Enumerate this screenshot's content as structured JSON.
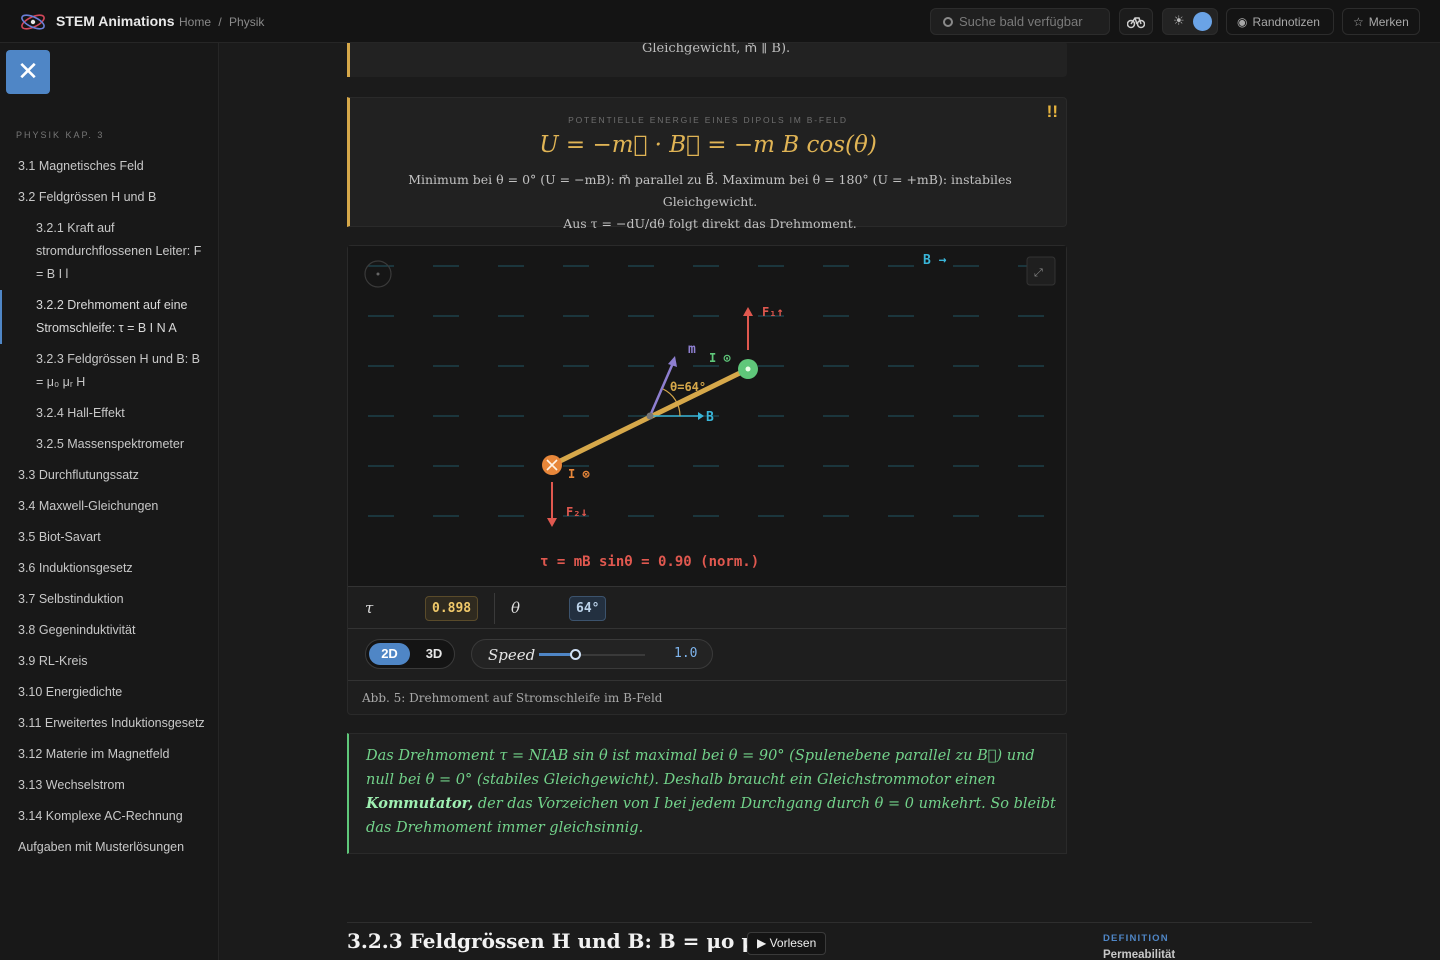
{
  "header": {
    "brand": "STEM Animations",
    "breadcrumbs": [
      "Home",
      "/",
      "Physik"
    ],
    "search_placeholder": "Suche bald verfügbar",
    "rand_label": "Randnotizen",
    "merken_label": "Merken"
  },
  "sidebar": {
    "heading": "PHYSIK KAP. 3",
    "items": [
      {
        "label": "3.1 Magnetisches Feld",
        "level": 1
      },
      {
        "label": "3.2 Feldgrössen H und B",
        "level": 1
      },
      {
        "label": "3.2.1 Kraft auf stromdurchflossenen Leiter: F = B I l",
        "level": 2
      },
      {
        "label": "3.2.2 Drehmoment auf eine Stromschleife: τ = B I N A",
        "level": 2,
        "active": true
      },
      {
        "label": "3.2.3 Feldgrössen H und B: B = μ₀ μᵣ H",
        "level": 2
      },
      {
        "label": "3.2.4 Hall-Effekt",
        "level": 2
      },
      {
        "label": "3.2.5 Massenspektrometer",
        "level": 2
      },
      {
        "label": "3.3 Durchflutungssatz",
        "level": 1
      },
      {
        "label": "3.4 Maxwell-Gleichungen",
        "level": 1
      },
      {
        "label": "3.5 Biot-Savart",
        "level": 1
      },
      {
        "label": "3.6 Induktionsgesetz",
        "level": 1
      },
      {
        "label": "3.7 Selbstinduktion",
        "level": 1
      },
      {
        "label": "3.8 Gegeninduktivität",
        "level": 1
      },
      {
        "label": "3.9 RL-Kreis",
        "level": 1
      },
      {
        "label": "3.10 Energiedichte",
        "level": 1
      },
      {
        "label": "3.11 Erweitertes Induktionsgesetz",
        "level": 1
      },
      {
        "label": "3.12 Materie im Magnetfeld",
        "level": 1
      },
      {
        "label": "3.13 Wechselstrom",
        "level": 1
      },
      {
        "label": "3.14 Komplexe AC-Rechnung",
        "level": 1
      },
      {
        "label": "Aufgaben mit Musterlösungen",
        "level": 1
      }
    ]
  },
  "prev_box": {
    "text": "Gleichgewicht, m⃗ ∥ B)."
  },
  "energy_box": {
    "label": "POTENTIELLE ENERGIE EINES DIPOLS IM B-FELD",
    "formula": "U = −m⃗ · B⃗ = −m B cos(θ)",
    "desc_line1": "Minimum bei θ = 0° (U = −mB): m⃗ parallel zu B⃗. Maximum bei θ = 180° (U = +mB): instabiles Gleichgewicht.",
    "desc_line2": "Aus τ = −dU/dθ folgt direkt das Drehmoment.",
    "badge": "!!"
  },
  "figure": {
    "labels": {
      "b_field": "B →",
      "f1": "F₁↑",
      "f2": "F₂↓",
      "m": "m",
      "i_top": "I ⊙",
      "i_bottom": "I ⊗",
      "theta": "θ=64°",
      "b_axis": "B",
      "torque": "τ = mB sinθ = 0.90 (norm.)"
    },
    "angle_deg": 64,
    "readout": {
      "tau_symbol": "τ",
      "tau_value": "0.898",
      "theta_symbol": "θ",
      "theta_value": "64°"
    },
    "mode": {
      "option_2d": "2D",
      "option_3d": "3D",
      "selected": "2D"
    },
    "speed": {
      "label": "Speed",
      "value": "1.0"
    },
    "caption": "Abb. 5: Drehmoment auf Stromschleife im B-Feld",
    "colors": {
      "accent": "#4f86c6",
      "gold": "#d6a84a",
      "green": "#5fc77a",
      "red": "#e0584f",
      "cyan": "#39b5d8"
    }
  },
  "note": {
    "text_a": "Das Drehmoment τ = NIAB sin θ ist maximal bei θ = 90° (Spulenebene parallel zu B⃗) und null bei θ = 0° (stabiles Gleichgewicht). Deshalb braucht ein Gleichstrommotor einen ",
    "bold": "Kommutator,",
    "text_b": " der das Vorzeichen von I bei jedem Durchgang durch θ = 0 umkehrt. So bleibt das Drehmoment immer gleichsinnig."
  },
  "next_section": {
    "title": "3.2.3 Feldgrössen H und B: B = μo μr H",
    "read_aloud": "▶ Vorlesen",
    "definition_label": "DEFINITION",
    "definition_term": "Permeabilität"
  }
}
